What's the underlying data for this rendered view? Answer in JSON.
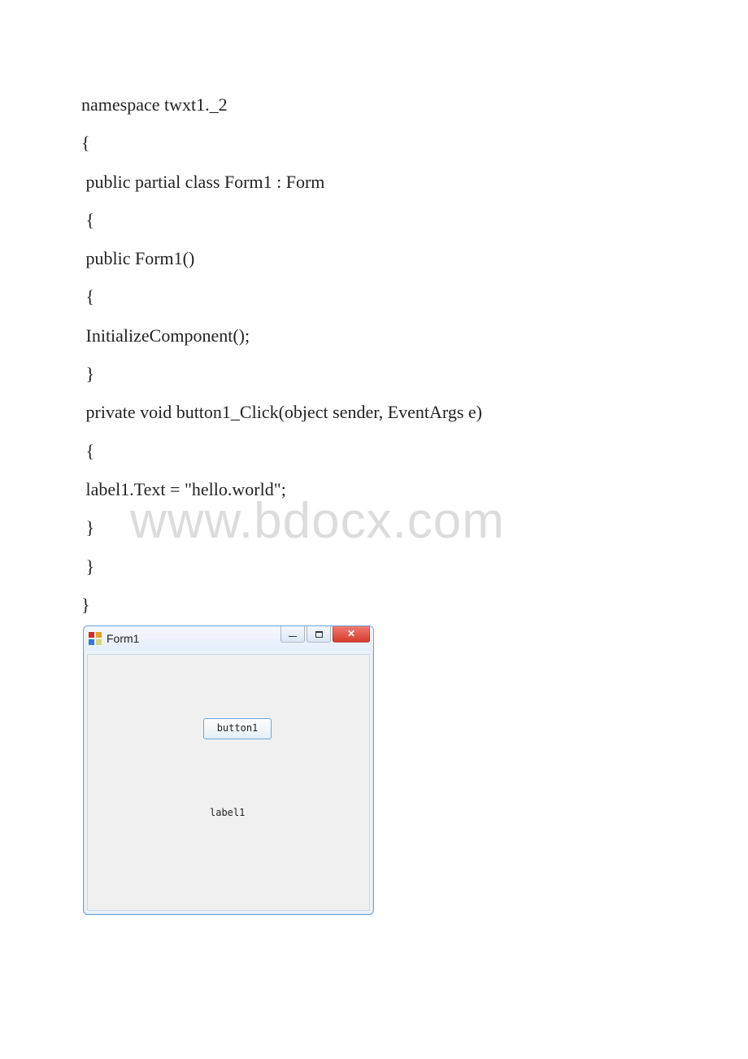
{
  "code": {
    "l1": "namespace twxt1._2",
    "l2": "{",
    "l3": " public partial class Form1 : Form",
    "l4": " {",
    "l5": " public Form1()",
    "l6": " {",
    "l7": " InitializeComponent();",
    "l8": " }",
    "l9": " private void button1_Click(object sender, EventArgs e)",
    "l10": " {",
    "l11": " label1.Text = \"hello.world\";",
    "l12": " }",
    "l13": " }",
    "l14": "}"
  },
  "window": {
    "title": "Form1",
    "button_text": "button1",
    "label_text": "label1"
  },
  "watermark": "www.bdocx.com"
}
